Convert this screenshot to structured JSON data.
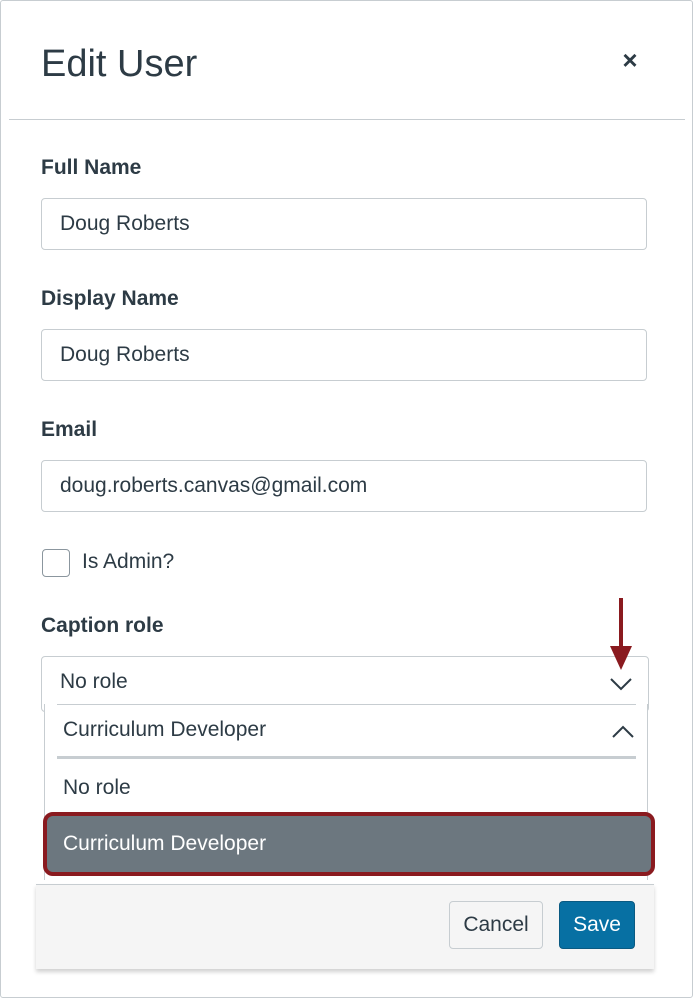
{
  "dialog": {
    "title": "Edit User",
    "close_glyph": "×"
  },
  "form": {
    "full_name": {
      "label": "Full Name",
      "value": "Doug Roberts"
    },
    "display_name": {
      "label": "Display Name",
      "value": "Doug Roberts"
    },
    "email": {
      "label": "Email",
      "value": "doug.roberts.canvas@gmail.com"
    },
    "is_admin": {
      "label": "Is Admin?",
      "checked": false
    },
    "caption_role": {
      "label": "Caption role",
      "current_value": "No role",
      "dropdown_selected": "Curriculum Developer",
      "options": [
        "No role",
        "Curriculum Developer"
      ],
      "highlighted_option": "Curriculum Developer"
    }
  },
  "footer": {
    "cancel_label": "Cancel",
    "save_label": "Save"
  },
  "colors": {
    "primary": "#0770a3",
    "annotation": "#8a1a1f",
    "highlight_bg": "#6c777f",
    "text": "#2d3b45"
  },
  "icons": {
    "close": "close-icon",
    "select_chevron": "chevron-down-icon",
    "dropdown_chevron": "chevron-up-icon",
    "annotation_arrow": "arrow-down-icon"
  }
}
